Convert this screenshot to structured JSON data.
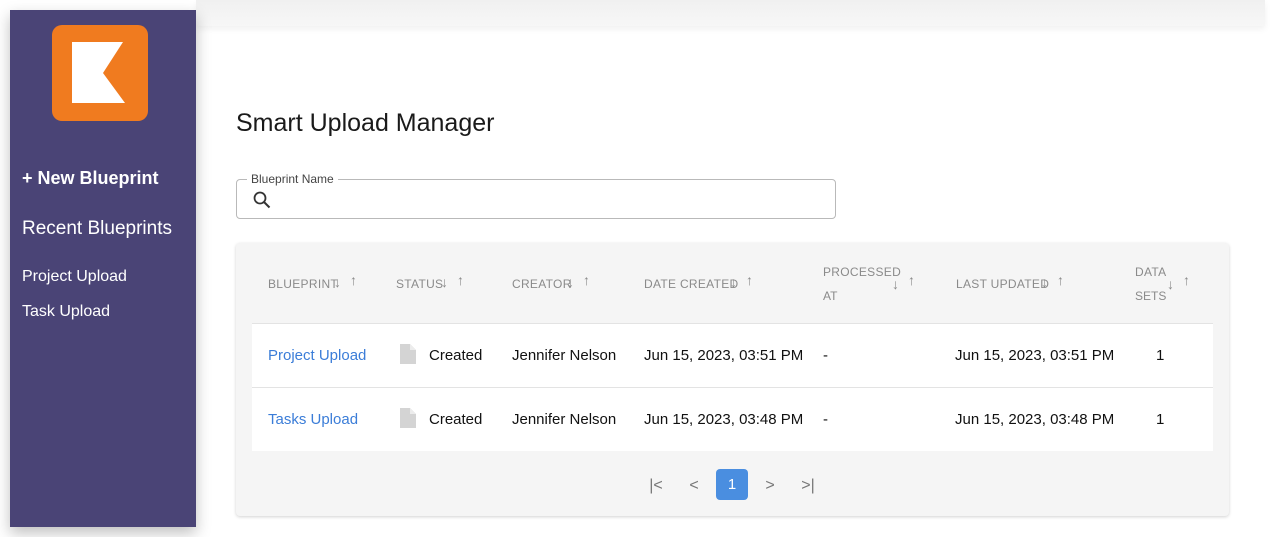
{
  "sidebar": {
    "logo_color": "#f07b1f",
    "new_blueprint": "+ New Blueprint",
    "recent_title": "Recent Blueprints",
    "recent_items": [
      {
        "label": "Project Upload"
      },
      {
        "label": "Task Upload"
      }
    ]
  },
  "main": {
    "title": "Smart Upload Manager",
    "search": {
      "label": "Blueprint Name",
      "value": "",
      "icon": "search-icon"
    }
  },
  "table": {
    "columns": [
      {
        "label": "BLUEPRINT"
      },
      {
        "label": "STATUS"
      },
      {
        "label": "CREATOR"
      },
      {
        "label": "DATE CREATED"
      },
      {
        "line1": "PROCESSED",
        "line2": "AT"
      },
      {
        "label": "LAST UPDATED"
      },
      {
        "line1": "DATA",
        "line2": "SETS"
      }
    ],
    "sort_down": "↓",
    "sort_up": "↑",
    "rows": [
      {
        "blueprint": "Project Upload",
        "status": "Created",
        "creator": "Jennifer Nelson",
        "date_created": "Jun 15, 2023, 03:51 PM",
        "processed_at": "-",
        "last_updated": "Jun 15, 2023, 03:51 PM",
        "data_sets": "1"
      },
      {
        "blueprint": "Tasks Upload",
        "status": "Created",
        "creator": "Jennifer Nelson",
        "date_created": "Jun 15, 2023, 03:48 PM",
        "processed_at": "-",
        "last_updated": "Jun 15, 2023, 03:48 PM",
        "data_sets": "1"
      }
    ]
  },
  "pagination": {
    "first": "|<",
    "prev": "<",
    "current": "1",
    "next": ">",
    "last": ">|",
    "active_color": "#4a8ee0"
  },
  "colors": {
    "sidebar_bg": "#4a4476",
    "link": "#3b7dd8"
  }
}
